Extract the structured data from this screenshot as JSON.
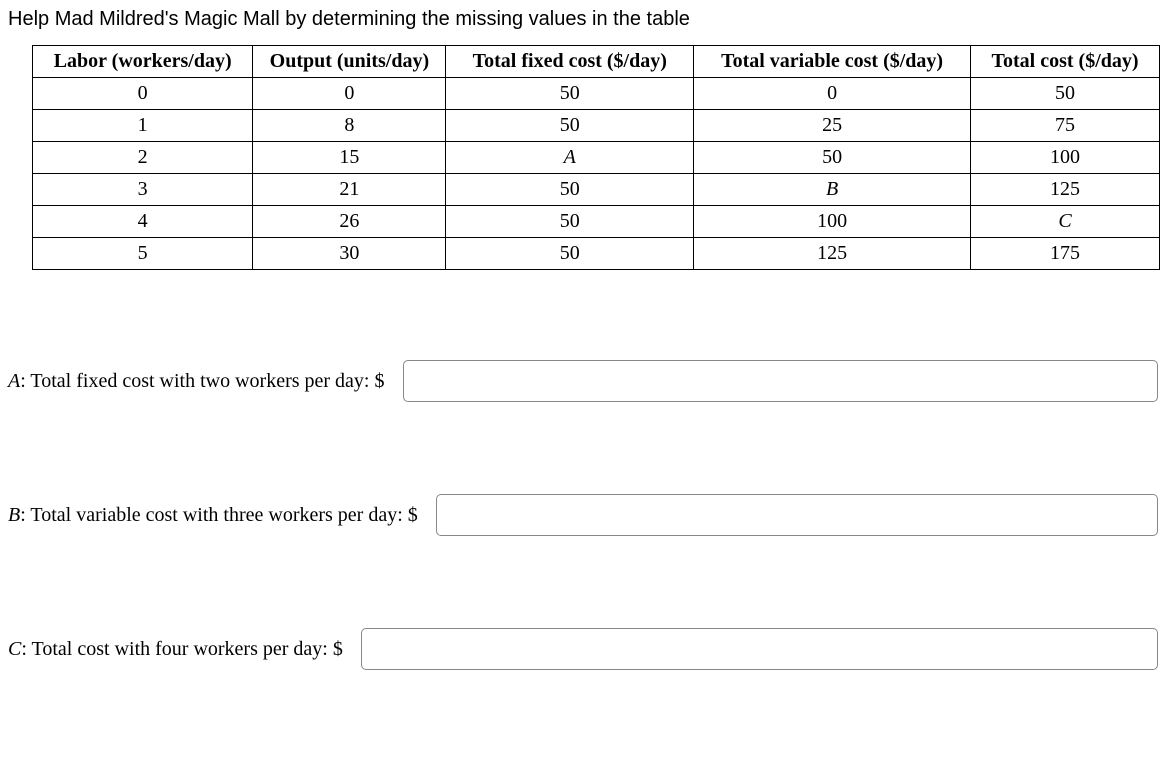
{
  "prompt": "Help Mad Mildred's Magic Mall by determining the missing values in the table",
  "table": {
    "headers": [
      "Labor (workers/day)",
      "Output (units/day)",
      "Total fixed cost ($/day)",
      "Total variable cost ($/day)",
      "Total cost ($/day)"
    ],
    "rows": [
      {
        "labor": "0",
        "output": "0",
        "tfc": "50",
        "tvc": "0",
        "tc": "50"
      },
      {
        "labor": "1",
        "output": "8",
        "tfc": "50",
        "tvc": "25",
        "tc": "75"
      },
      {
        "labor": "2",
        "output": "15",
        "tfc": "A",
        "tfc_italic": true,
        "tvc": "50",
        "tc": "100"
      },
      {
        "labor": "3",
        "output": "21",
        "tfc": "50",
        "tvc": "B",
        "tvc_italic": true,
        "tc": "125"
      },
      {
        "labor": "4",
        "output": "26",
        "tfc": "50",
        "tvc": "100",
        "tc": "C",
        "tc_italic": true
      },
      {
        "labor": "5",
        "output": "30",
        "tfc": "50",
        "tvc": "125",
        "tc": "175"
      }
    ]
  },
  "questions": {
    "a": {
      "var": "A",
      "text": ": Total fixed cost with two workers per day: $"
    },
    "b": {
      "var": "B",
      "text": ": Total variable cost with three workers per day: $"
    },
    "c": {
      "var": "C",
      "text": ": Total cost with four workers per day: $"
    }
  }
}
